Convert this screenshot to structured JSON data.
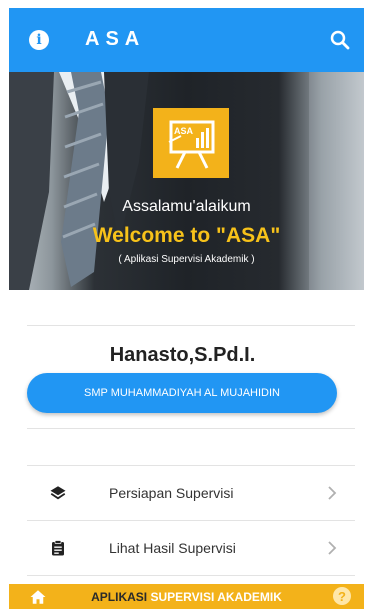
{
  "appbar": {
    "title": "ASA",
    "info_icon": "info-icon",
    "search_icon": "search-icon",
    "color": "#2196f3"
  },
  "hero": {
    "greeting": "Assalamu'alaikum",
    "welcome": "Welcome to \"ASA\"",
    "subtitle": "( Aplikasi Supervisi Akademik )",
    "logo_text": "ASA",
    "logo_color": "#f3b21a"
  },
  "user": {
    "name": "Hanasto,S.Pd.I.",
    "school": "SMP MUHAMMADIYAH AL MUJAHIDIN"
  },
  "menu": [
    {
      "label": "Persiapan Supervisi",
      "icon": "layers-icon"
    },
    {
      "label": "Lihat Hasil Supervisi",
      "icon": "clipboard-icon"
    }
  ],
  "bottom_bar": {
    "text_part1": "APLIKASI",
    "text_part2": "SUPERVISI AKADEMIK",
    "home_icon": "home-icon",
    "help_icon": "help-icon",
    "help_glyph": "?",
    "color": "#f3b21a"
  }
}
